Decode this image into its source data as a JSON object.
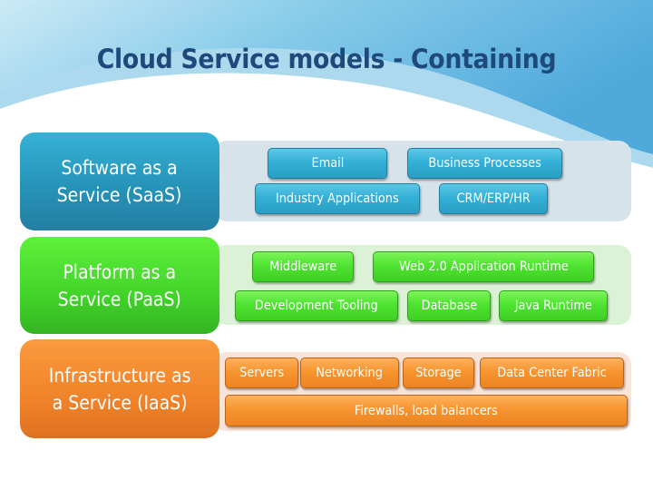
{
  "slide": {
    "title": "Cloud Service models - Containing",
    "colors": {
      "title": "#1d4a7a",
      "saas": "#2a9ec4",
      "paas": "#42d42a",
      "iaas": "#f0832a",
      "background_wave": "#5aafdc"
    }
  },
  "models": [
    {
      "name": "Software as a Service (SaaS)",
      "line1": "Software as a",
      "line2": "Service (SaaS)",
      "components": [
        "Email",
        "Business Processes",
        "Industry Applications",
        "CRM/ERP/HR"
      ]
    },
    {
      "name": "Platform as a Service (PaaS)",
      "line1": "Platform as a",
      "line2": "Service (PaaS)",
      "components": [
        "Middleware",
        "Web 2.0 Application Runtime",
        "Development Tooling",
        "Database",
        "Java Runtime"
      ]
    },
    {
      "name": "Infrastructure as a Service (IaaS)",
      "line1": "Infrastructure as",
      "line2": "a Service (IaaS)",
      "components": [
        "Servers",
        "Networking",
        "Storage",
        "Data Center Fabric",
        "Firewalls, load balancers"
      ]
    }
  ]
}
